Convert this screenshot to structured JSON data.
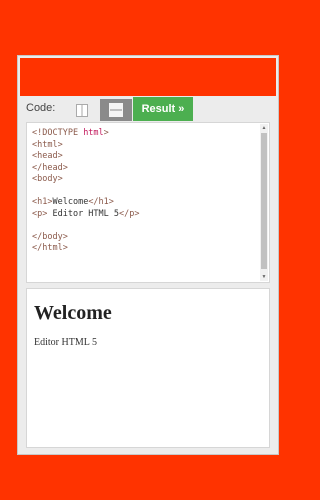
{
  "toolbar": {
    "code_label": "Code:",
    "result_label": "Result »"
  },
  "layout_buttons": [
    {
      "icon": "split-columns-icon",
      "active": false
    },
    {
      "icon": "split-rows-icon",
      "active": true
    }
  ],
  "editor": {
    "lines": [
      {
        "parts": [
          [
            "tag",
            "<!DOCTYPE "
          ],
          [
            "kw",
            "html"
          ],
          [
            "tag",
            ">"
          ]
        ]
      },
      {
        "parts": [
          [
            "tag",
            "<html>"
          ]
        ]
      },
      {
        "parts": [
          [
            "tag",
            "<head>"
          ]
        ]
      },
      {
        "parts": [
          [
            "tag",
            "</head>"
          ]
        ]
      },
      {
        "parts": [
          [
            "tag",
            "<body>"
          ]
        ]
      },
      {
        "parts": []
      },
      {
        "parts": [
          [
            "tag",
            "<h1>"
          ],
          [
            "txt",
            "Welcome"
          ],
          [
            "tag",
            "</h1>"
          ]
        ]
      },
      {
        "parts": [
          [
            "tag",
            "<p>"
          ],
          [
            "txt",
            " Editor HTML 5"
          ],
          [
            "tag",
            "</p>"
          ]
        ]
      },
      {
        "parts": []
      },
      {
        "parts": [
          [
            "tag",
            "</body>"
          ]
        ]
      },
      {
        "parts": [
          [
            "tag",
            "</html>"
          ]
        ]
      }
    ]
  },
  "preview": {
    "heading": "Welcome",
    "paragraph": "Editor HTML 5"
  },
  "colors": {
    "page_background": "#ff3300",
    "result_button": "#4caf50",
    "tag_color": "#8b5a4b",
    "keyword_color": "#c2185b"
  }
}
